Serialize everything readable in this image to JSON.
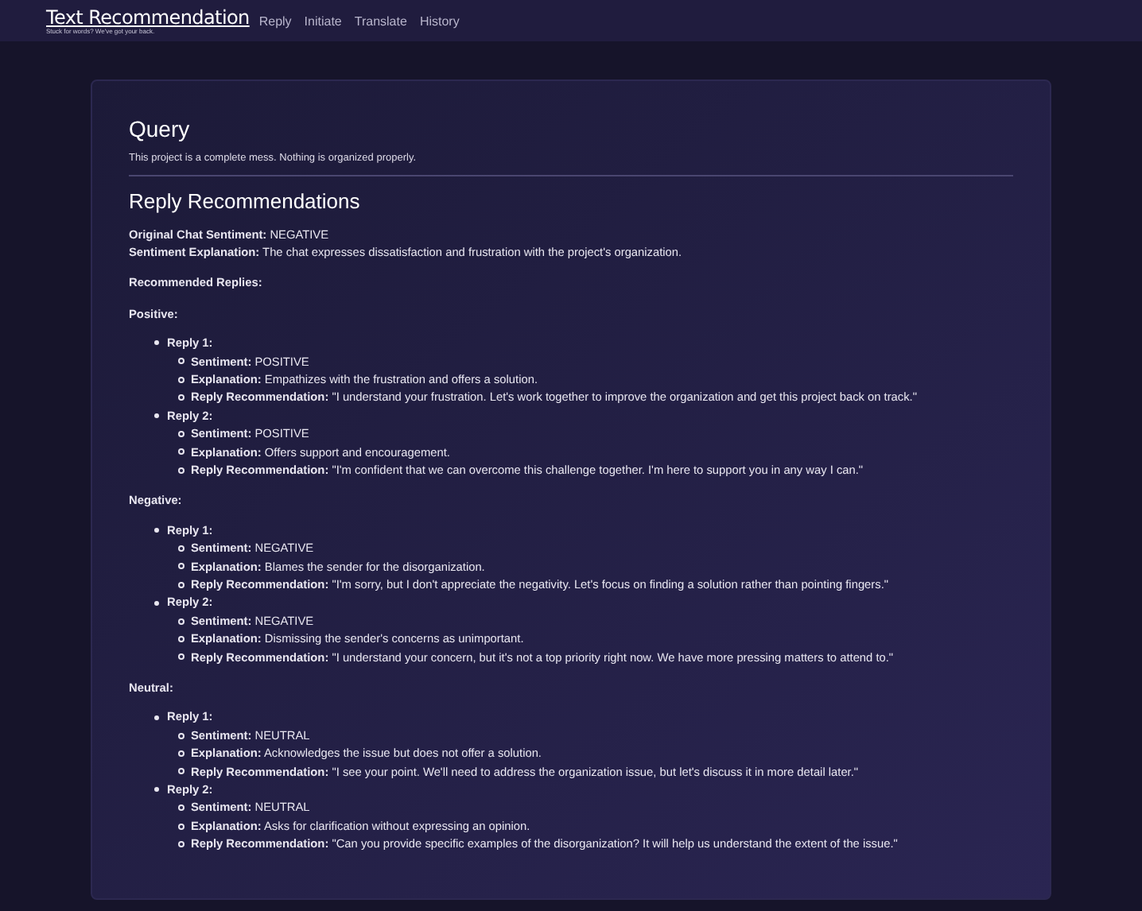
{
  "nav": {
    "logo": "Text Recommendation",
    "tagline": "Stuck for words? We've got your back.",
    "links": [
      "Reply",
      "Initiate",
      "Translate",
      "History"
    ]
  },
  "query": {
    "title": "Query",
    "text": "This project is a complete mess. Nothing is organized properly."
  },
  "recommendations": {
    "title": "Reply Recommendations",
    "summary": [
      "**Original Chat Sentiment:** NEGATIVE",
      "**Sentiment Explanation:** The chat expresses dissatisfaction and frustration with the project's organization."
    ],
    "subtitle": "Recommended Replies:",
    "groups": [
      {
        "heading": "Positive:",
        "replies": [
          {
            "label": "Reply 1:",
            "items": [
              "**Sentiment:** POSITIVE",
              "**Explanation:** Empathizes with the frustration and offers a solution.",
              "**Reply Recommendation:** \"I understand your frustration. Let's work together to improve the organization and get this project back on track.\""
            ]
          },
          {
            "label": "Reply 2:",
            "items": [
              "**Sentiment:** POSITIVE",
              "**Explanation:** Offers support and encouragement.",
              "**Reply Recommendation:** \"I'm confident that we can overcome this challenge together. I'm here to support you in any way I can.\""
            ]
          }
        ]
      },
      {
        "heading": "Negative:",
        "replies": [
          {
            "label": "Reply 1:",
            "items": [
              "**Sentiment:** NEGATIVE",
              "**Explanation:** Blames the sender for the disorganization.",
              "**Reply Recommendation:** \"I'm sorry, but I don't appreciate the negativity. Let's focus on finding a solution rather than pointing fingers.\""
            ]
          },
          {
            "label": "Reply 2:",
            "items": [
              "**Sentiment:** NEGATIVE",
              "**Explanation:** Dismissing the sender's concerns as unimportant.",
              "**Reply Recommendation:** \"I understand your concern, but it's not a top priority right now. We have more pressing matters to attend to.\""
            ]
          }
        ]
      },
      {
        "heading": "Neutral:",
        "replies": [
          {
            "label": "Reply 1:",
            "items": [
              "**Sentiment:** NEUTRAL",
              "**Explanation:** Acknowledges the issue but does not offer a solution.",
              "**Reply Recommendation:** \"I see your point. We'll need to address the organization issue, but let's discuss it in more detail later.\""
            ]
          },
          {
            "label": "Reply 2:",
            "items": [
              "**Sentiment:** NEUTRAL",
              "**Explanation:** Asks for clarification without expressing an opinion.",
              "**Reply Recommendation:** \"Can you provide specific examples of the disorganization? It will help us understand the extent of the issue.\""
            ]
          }
        ]
      }
    ]
  }
}
